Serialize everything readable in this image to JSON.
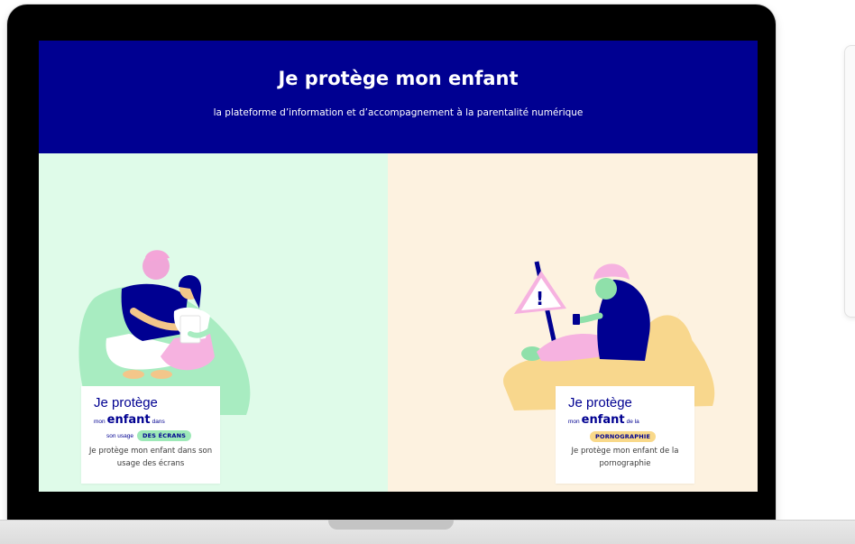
{
  "site": {
    "title": "Je protège mon enfant",
    "subtitle": "la plateforme d’information et d’accompagnement à la parentalité numérique"
  },
  "cards": [
    {
      "logo_title": "Je protège",
      "logo_prefix": "mon",
      "logo_emphasis": "enfant",
      "logo_suffix": "dans",
      "logo_line3": "son usage",
      "logo_tag": "DES ÉCRANS",
      "caption": "Je protège mon enfant dans son usage des écrans"
    },
    {
      "logo_title": "Je protège",
      "logo_prefix": "mon",
      "logo_emphasis": "enfant",
      "logo_suffix": "de la",
      "logo_tag": "PORNOGRAPHIE",
      "caption": "Je protège mon enfant de la pornographie"
    }
  ],
  "colors": {
    "header_bg": "#000091",
    "left_panel_bg": "#dffbe9",
    "right_panel_bg": "#fdf2e0",
    "brand_text": "#000091"
  }
}
